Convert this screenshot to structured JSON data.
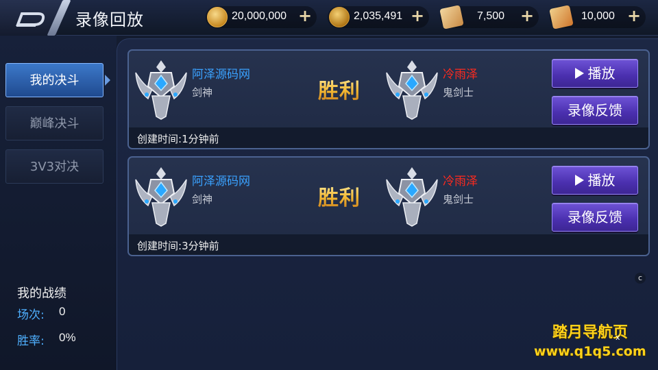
{
  "header": {
    "title": "录像回放",
    "back_icon": "back-arrow-icon",
    "currencies": [
      {
        "icon": "gold-coin-icon",
        "value": "20,000,000"
      },
      {
        "icon": "bound-coin-icon",
        "value": "2,035,491"
      },
      {
        "icon": "scroll-icon",
        "value": "7,500"
      },
      {
        "icon": "locked-scroll-icon",
        "value": "10,000"
      }
    ],
    "plus_glyph": "+"
  },
  "sidebar": {
    "tabs": [
      {
        "label": "我的决斗",
        "active": true
      },
      {
        "label": "巅峰决斗",
        "active": false
      },
      {
        "label": "3V3对决",
        "active": false
      }
    ],
    "stats": {
      "title": "我的战绩",
      "matches_label": "场次:",
      "matches_value": "0",
      "winrate_label": "胜率:",
      "winrate_value": "0%"
    }
  },
  "records": [
    {
      "player1": {
        "name": "阿泽源码网",
        "class": "剑神"
      },
      "result": "胜利",
      "player2": {
        "name": "冷雨泽",
        "class": "鬼剑士"
      },
      "play_label": "播放",
      "feedback_label": "录像反馈",
      "created_label": "创建时间:",
      "created_value": "1分钟前"
    },
    {
      "player1": {
        "name": "阿泽源码网",
        "class": "剑神"
      },
      "result": "胜利",
      "player2": {
        "name": "冷雨泽",
        "class": "鬼剑士"
      },
      "play_label": "播放",
      "feedback_label": "录像反馈",
      "created_label": "创建时间:",
      "created_value": "3分钟前"
    }
  ],
  "overlay": {
    "corner_mark": "c",
    "watermark_line1": "踏月导航页",
    "watermark_line2": "www.q1q5.com",
    "watermark_close": "x"
  },
  "colors": {
    "accent_blue": "#3aa2ff",
    "opponent_red": "#ff2a1e",
    "victory_gold": "#ffd34d",
    "button_purple": "#5a3fc4",
    "active_tab": "#3c78c9"
  }
}
